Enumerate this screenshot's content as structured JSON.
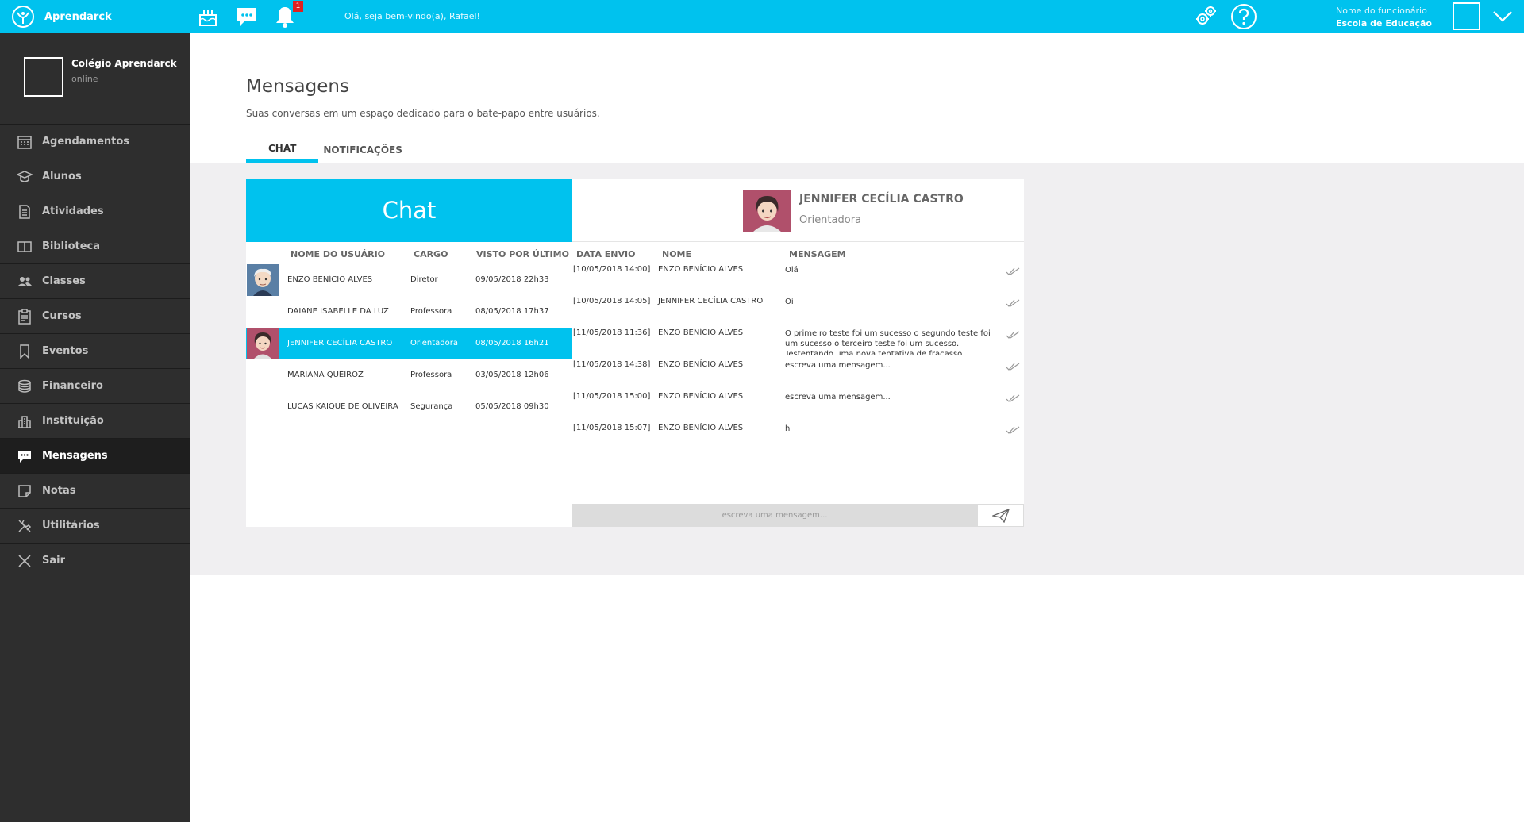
{
  "topbar": {
    "brand": "Aprendarck",
    "welcome": "Olá, seja bem-vindo(a), Rafael!",
    "notification_count": "1",
    "user_role": "Nome do funcionário",
    "user_school": "Escola de Educação",
    "icons": [
      "cake-icon",
      "chat-bubble-icon",
      "bell-icon",
      "gears-icon",
      "help-icon",
      "chevron-down-icon"
    ]
  },
  "sidebar": {
    "school_name": "Colégio Aprendarck",
    "school_status": "online",
    "items": [
      {
        "label": "Agendamentos",
        "icon": "calendar-icon"
      },
      {
        "label": "Alunos",
        "icon": "graduation-cap-icon"
      },
      {
        "label": "Atividades",
        "icon": "document-icon"
      },
      {
        "label": "Biblioteca",
        "icon": "book-icon"
      },
      {
        "label": "Classes",
        "icon": "users-icon"
      },
      {
        "label": "Cursos",
        "icon": "clipboard-icon"
      },
      {
        "label": "Eventos",
        "icon": "bookmark-icon"
      },
      {
        "label": "Financeiro",
        "icon": "coins-icon"
      },
      {
        "label": "Instituição",
        "icon": "building-icon"
      },
      {
        "label": "Mensagens",
        "icon": "message-icon",
        "active": true
      },
      {
        "label": "Notas",
        "icon": "note-icon"
      },
      {
        "label": "Utilitários",
        "icon": "tools-icon"
      },
      {
        "label": "Sair",
        "icon": "close-icon"
      }
    ]
  },
  "page": {
    "title": "Mensagens",
    "subtitle": "Suas conversas em um espaço dedicado para o bate-papo entre usuários.",
    "tabs": [
      {
        "label": "CHAT",
        "active": true
      },
      {
        "label": "NOTIFICAÇÕES",
        "active": false
      }
    ]
  },
  "chat": {
    "header": "Chat",
    "columns": [
      "NOME DO USUÁRIO",
      "CARGO",
      "VISTO POR ÚLTIMO"
    ],
    "users": [
      {
        "name": "ENZO BENÍCIO ALVES",
        "role": "Diretor",
        "last_seen": "09/05/2018 22h33",
        "avatar": "old-man-avatar"
      },
      {
        "name": "DAIANE ISABELLE DA LUZ",
        "role": "Professora",
        "last_seen": "08/05/2018 17h37",
        "avatar": ""
      },
      {
        "name": "JENNIFER CECÍLIA CASTRO",
        "role": "Orientadora",
        "last_seen": "08/05/2018 16h21",
        "avatar": "woman-avatar",
        "selected": true
      },
      {
        "name": "MARIANA QUEIROZ",
        "role": "Professora",
        "last_seen": "03/05/2018 12h06",
        "avatar": ""
      },
      {
        "name": "LUCAS KAIQUE DE OLIVEIRA",
        "role": "Segurança",
        "last_seen": "05/05/2018 09h30",
        "avatar": ""
      }
    ]
  },
  "conversation": {
    "contact_name": "JENNIFER CECÍLIA CASTRO",
    "contact_role": "Orientadora",
    "columns": [
      "DATA ENVIO",
      "NOME",
      "MENSAGEM"
    ],
    "messages": [
      {
        "date": "[10/05/2018 14:00]",
        "name": "ENZO BENÍCIO ALVES",
        "text": "Olá"
      },
      {
        "date": "[10/05/2018 14:05]",
        "name": "JENNIFER CECÍLIA CASTRO",
        "text": "Oi"
      },
      {
        "date": "[11/05/2018 11:36]",
        "name": "ENZO BENÍCIO ALVES",
        "text": "O primeiro teste foi um sucesso o segundo teste foi um sucesso o terceiro teste foi um sucesso. Testentando uma nova tentativa de fracasso. Verificando"
      },
      {
        "date": "[11/05/2018 14:38]",
        "name": "ENZO BENÍCIO ALVES",
        "text": "escreva uma mensagem..."
      },
      {
        "date": "[11/05/2018 15:00]",
        "name": "ENZO BENÍCIO ALVES",
        "text": "escreva uma mensagem..."
      },
      {
        "date": "[11/05/2018 15:07]",
        "name": "ENZO BENÍCIO ALVES",
        "text": "h"
      }
    ],
    "composer_placeholder": "escreva uma mensagem...",
    "send_icon": "paper-plane-icon"
  },
  "colors": {
    "accent": "#00c2ee",
    "sidebar_bg": "#2e2e2e",
    "content_gray": "#f0eff1"
  }
}
